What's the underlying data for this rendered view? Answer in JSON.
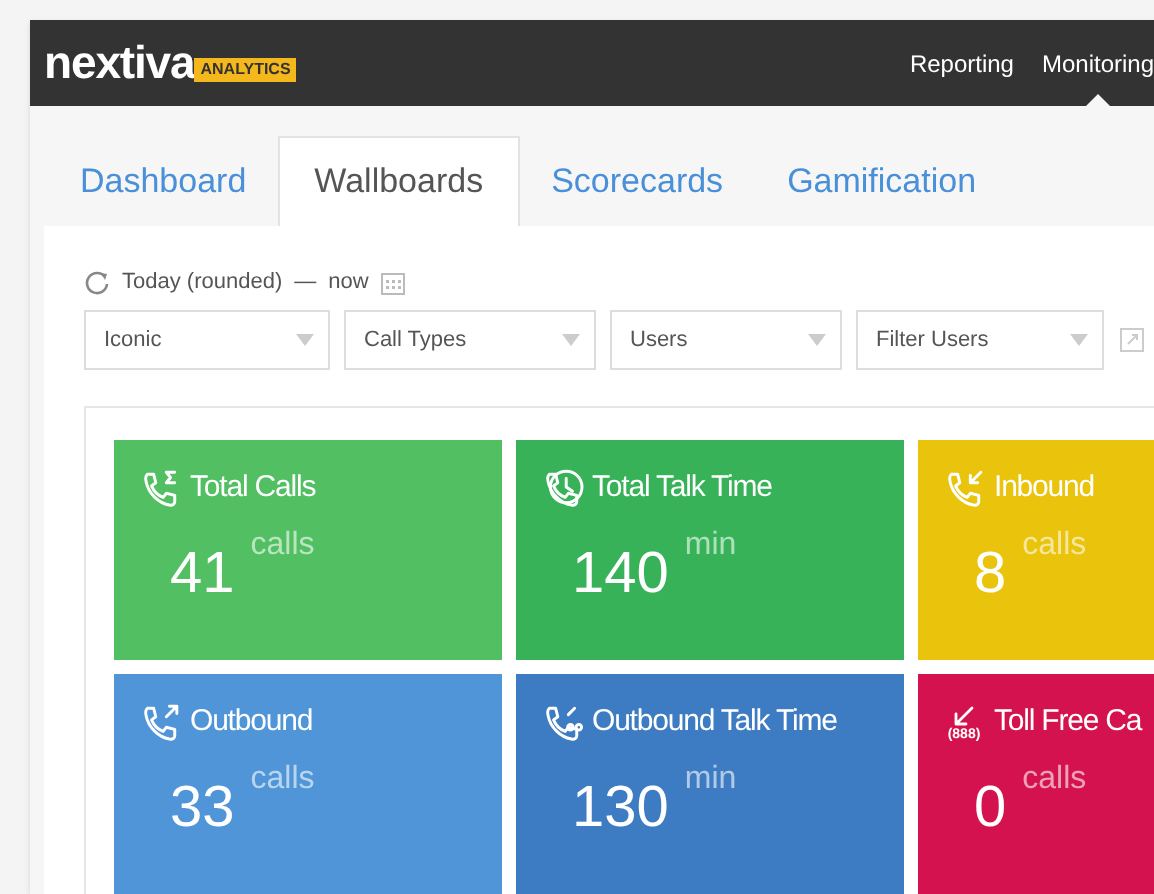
{
  "header": {
    "logo": "nextiva",
    "logo_badge": "ANALYTICS",
    "nav": [
      {
        "label": "Reporting",
        "selected": false
      },
      {
        "label": "Monitoring",
        "selected": true
      }
    ]
  },
  "tabs": [
    {
      "label": "Dashboard",
      "selected": false
    },
    {
      "label": "Wallboards",
      "selected": true
    },
    {
      "label": "Scorecards",
      "selected": false
    },
    {
      "label": "Gamification",
      "selected": false
    }
  ],
  "date_range": {
    "from": "Today (rounded)",
    "separator": "—",
    "to": "now"
  },
  "filters": [
    {
      "value": "Iconic"
    },
    {
      "value": "Call Types"
    },
    {
      "value": "Users"
    },
    {
      "value": "Filter Users"
    }
  ],
  "tiles": [
    {
      "kind": "total",
      "title": "Total Calls",
      "value": "41",
      "unit": "calls",
      "color": "#52bf62"
    },
    {
      "kind": "talk",
      "title": "Total Talk Time",
      "value": "140",
      "unit": "min",
      "color": "#38b258"
    },
    {
      "kind": "inbound",
      "title": "Inbound",
      "value": "8",
      "unit": "calls",
      "color": "#eac30c"
    },
    {
      "kind": "outbound",
      "title": "Outbound",
      "value": "33",
      "unit": "calls",
      "color": "#4f95d8"
    },
    {
      "kind": "outtalk",
      "title": "Outbound Talk Time",
      "value": "130",
      "unit": "min",
      "color": "#3d7cc2"
    },
    {
      "kind": "tollfree",
      "title": "Toll Free Ca",
      "icon_label": "(888)",
      "value": "0",
      "unit": "calls",
      "color": "#d4124f"
    }
  ]
}
